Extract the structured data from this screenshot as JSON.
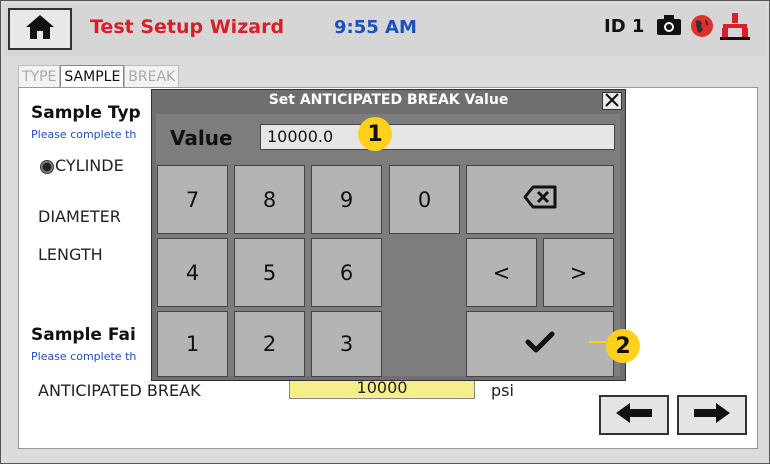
{
  "header": {
    "title": "Test Setup Wizard",
    "time": "9:55 AM",
    "device_id": "ID 1",
    "title_color": "#d8202a",
    "time_color": "#1d4fbf"
  },
  "tabs": [
    {
      "label": "TYPE",
      "active": false
    },
    {
      "label": "SAMPLE",
      "active": true
    },
    {
      "label": "BREAK",
      "active": false
    }
  ],
  "sample_type": {
    "heading": "Sample Typ",
    "note": "Please complete th",
    "option_label": "CYLINDE",
    "diameter_label": "DIAMETER",
    "length_label": "LENGTH"
  },
  "sample_failure": {
    "heading": "Sample Fai",
    "note": "Please complete th",
    "anticipated_label": "ANTICIPATED BREAK",
    "anticipated_value": "10000",
    "unit": "psi"
  },
  "dialog": {
    "title": "Set ANTICIPATED BREAK Value",
    "value_label": "Value",
    "value": "10000.0",
    "keys": {
      "k7": "7",
      "k8": "8",
      "k9": "9",
      "k0": "0",
      "k4": "4",
      "k5": "5",
      "k6": "6",
      "k1": "1",
      "k2": "2",
      "k3": "3",
      "left": "<",
      "right": ">"
    }
  },
  "callouts": {
    "one": "1",
    "two": "2",
    "color": "#ffd11a"
  }
}
